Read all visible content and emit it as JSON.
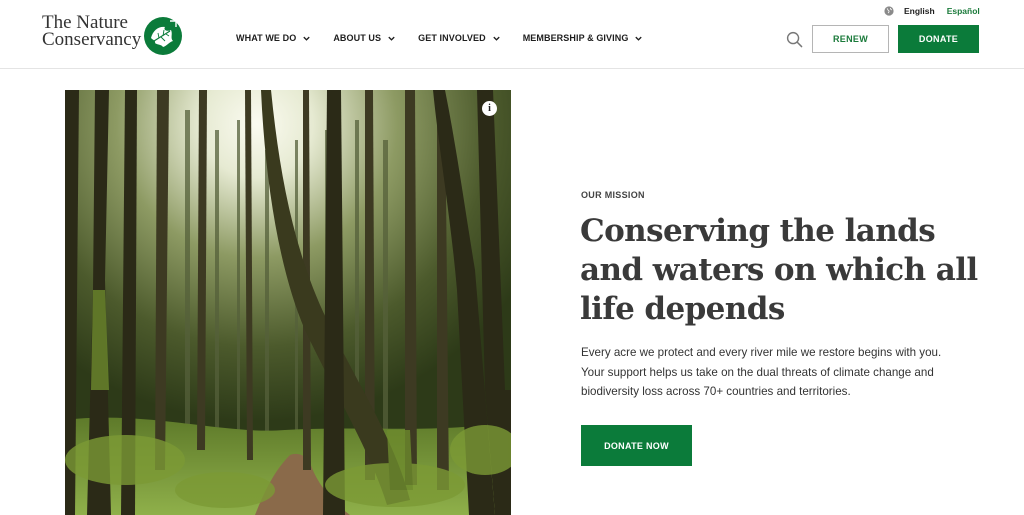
{
  "brand": {
    "logo_line1": "The Nature",
    "logo_line2": "Conservancy",
    "brand_green": "#0b7b3a"
  },
  "language": {
    "english_label": "English",
    "espanol_label": "Español"
  },
  "nav": {
    "items": [
      {
        "label": "WHAT WE DO"
      },
      {
        "label": "ABOUT US"
      },
      {
        "label": "GET INVOLVED"
      },
      {
        "label": "MEMBERSHIP & GIVING"
      }
    ]
  },
  "header_actions": {
    "renew_label": "RENEW",
    "donate_label": "DONATE"
  },
  "hero": {
    "image_subject": "forest with tall trees and mossy path",
    "info_glyph": "i"
  },
  "mission": {
    "eyebrow": "OUR MISSION",
    "headline": "Conserving the lands and waters on which all life depends",
    "body": "Every acre we protect and every river mile we restore begins with you. Your support helps us take on the dual threats of climate change and biodiversity loss across 70+ countries and territories.",
    "cta_label": "DONATE NOW"
  }
}
